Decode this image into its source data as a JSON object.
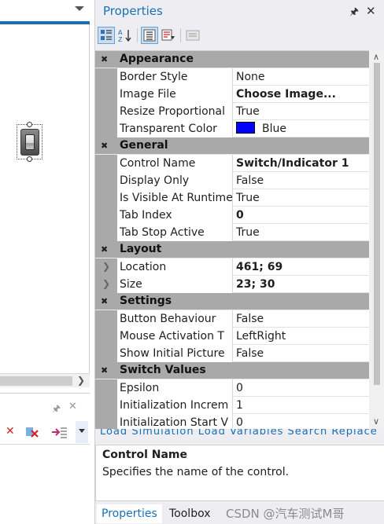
{
  "properties_panel": {
    "title": "Properties",
    "toolbar": [
      "categorized",
      "alphabetical",
      "properties",
      "events",
      "property-pages"
    ],
    "categories": [
      {
        "name": "Appearance",
        "rows": [
          {
            "name": "Border Style",
            "value": "None"
          },
          {
            "name": "Image File",
            "value": "Choose Image...",
            "bold": true
          },
          {
            "name": "Resize Proportional",
            "value": "True"
          },
          {
            "name": "Transparent Color",
            "value": "Blue",
            "swatch": "#0000ff"
          }
        ]
      },
      {
        "name": "General",
        "rows": [
          {
            "name": "Control Name",
            "value": "Switch/Indicator 1",
            "bold": true
          },
          {
            "name": "Display Only",
            "value": "False"
          },
          {
            "name": "Is Visible At Runtime",
            "value": "True"
          },
          {
            "name": "Tab Index",
            "value": "0",
            "bold": true
          },
          {
            "name": "Tab Stop Active",
            "value": "True"
          }
        ]
      },
      {
        "name": "Layout",
        "rows": [
          {
            "name": "Location",
            "value": "461; 69",
            "bold": true,
            "expandable": true
          },
          {
            "name": "Size",
            "value": "23; 30",
            "bold": true,
            "expandable": true
          }
        ]
      },
      {
        "name": "Settings",
        "rows": [
          {
            "name": "Button Behaviour",
            "value": "False"
          },
          {
            "name": "Mouse Activation T",
            "value": "LeftRight"
          },
          {
            "name": "Show Initial Picture",
            "value": "False"
          }
        ]
      },
      {
        "name": "Switch Values",
        "rows": [
          {
            "name": "Epsilon",
            "value": "0"
          },
          {
            "name": "Initialization Increm",
            "value": "1"
          },
          {
            "name": "Initialization Start V",
            "value": "0"
          }
        ]
      }
    ],
    "hint_links": "Load Simulation  Load Variables  Search Replace",
    "description": {
      "title": "Control Name",
      "text": "Specifies the name of the control."
    }
  },
  "tabs": [
    "Properties",
    "Toolbox"
  ],
  "watermark": "CSDN @汽车测试M哥",
  "colors": {
    "accent": "#1a6fb5",
    "category_bg": "#a9a9a9"
  }
}
